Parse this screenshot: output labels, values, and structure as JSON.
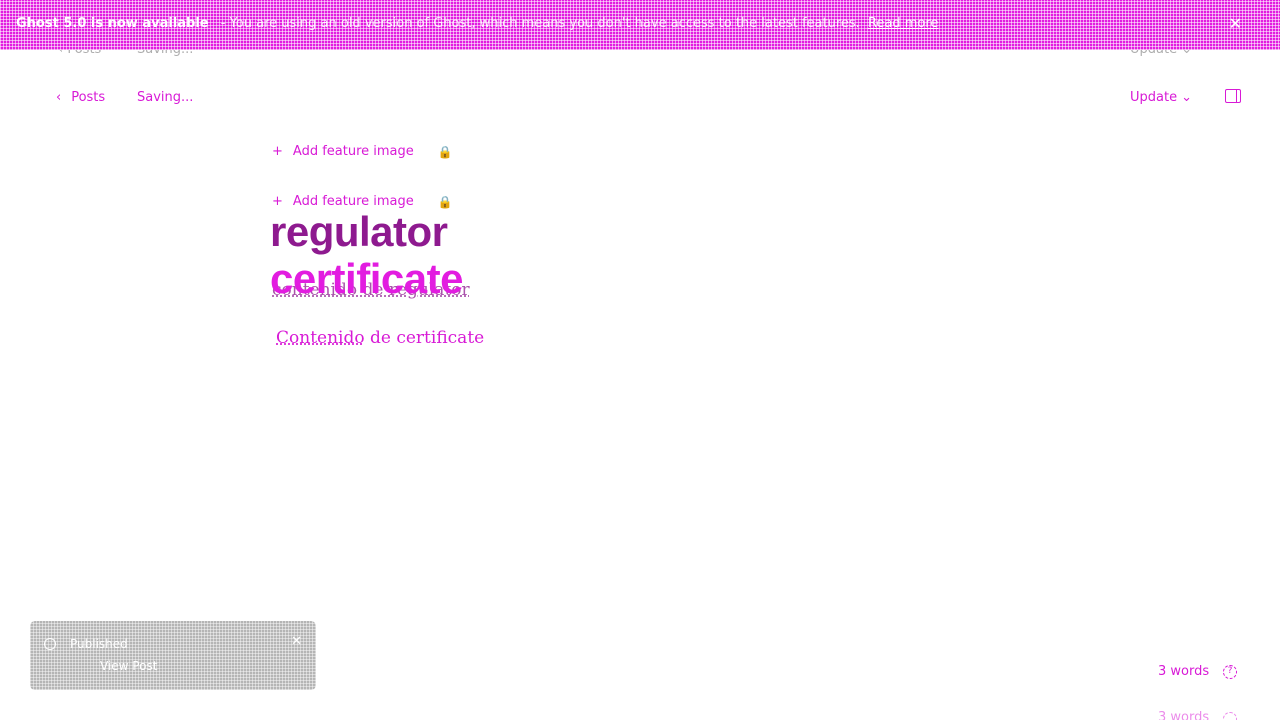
{
  "banner": {
    "title": "Ghost 5.0 is now available",
    "message": "- You are using an old version of Ghost, which means you don't have access to the latest features.",
    "link": "Read more",
    "close_glyph": "✕"
  },
  "header": {
    "back_label": "Posts",
    "back_glyph": "‹",
    "status": "Saving...",
    "update_label": "Update",
    "update_glyph": "⌄"
  },
  "feature_image": {
    "label": "Add feature image",
    "plus_glyph": "+",
    "lock_glyph": "🔒"
  },
  "post": {
    "title_line_1": "regulator",
    "title_line_2": "certificate",
    "body_ghost": "contenido de regulator",
    "body_word_1": "Contenido",
    "body_rest": " de certificate"
  },
  "toast": {
    "title": "Published",
    "link": "View Post",
    "close_glyph": "✕"
  },
  "footer": {
    "word_count": "3 words",
    "help_glyph": "?"
  },
  "colors": {
    "accent": "#d81ad6",
    "title_dark": "#8e1a8f",
    "toast": "#b5b5b5"
  },
  "icons": [
    "chevron-left-icon",
    "chevron-down-icon",
    "sidebar-toggle-icon",
    "plus-icon",
    "lock-icon",
    "published-icon",
    "close-icon",
    "help-icon"
  ]
}
